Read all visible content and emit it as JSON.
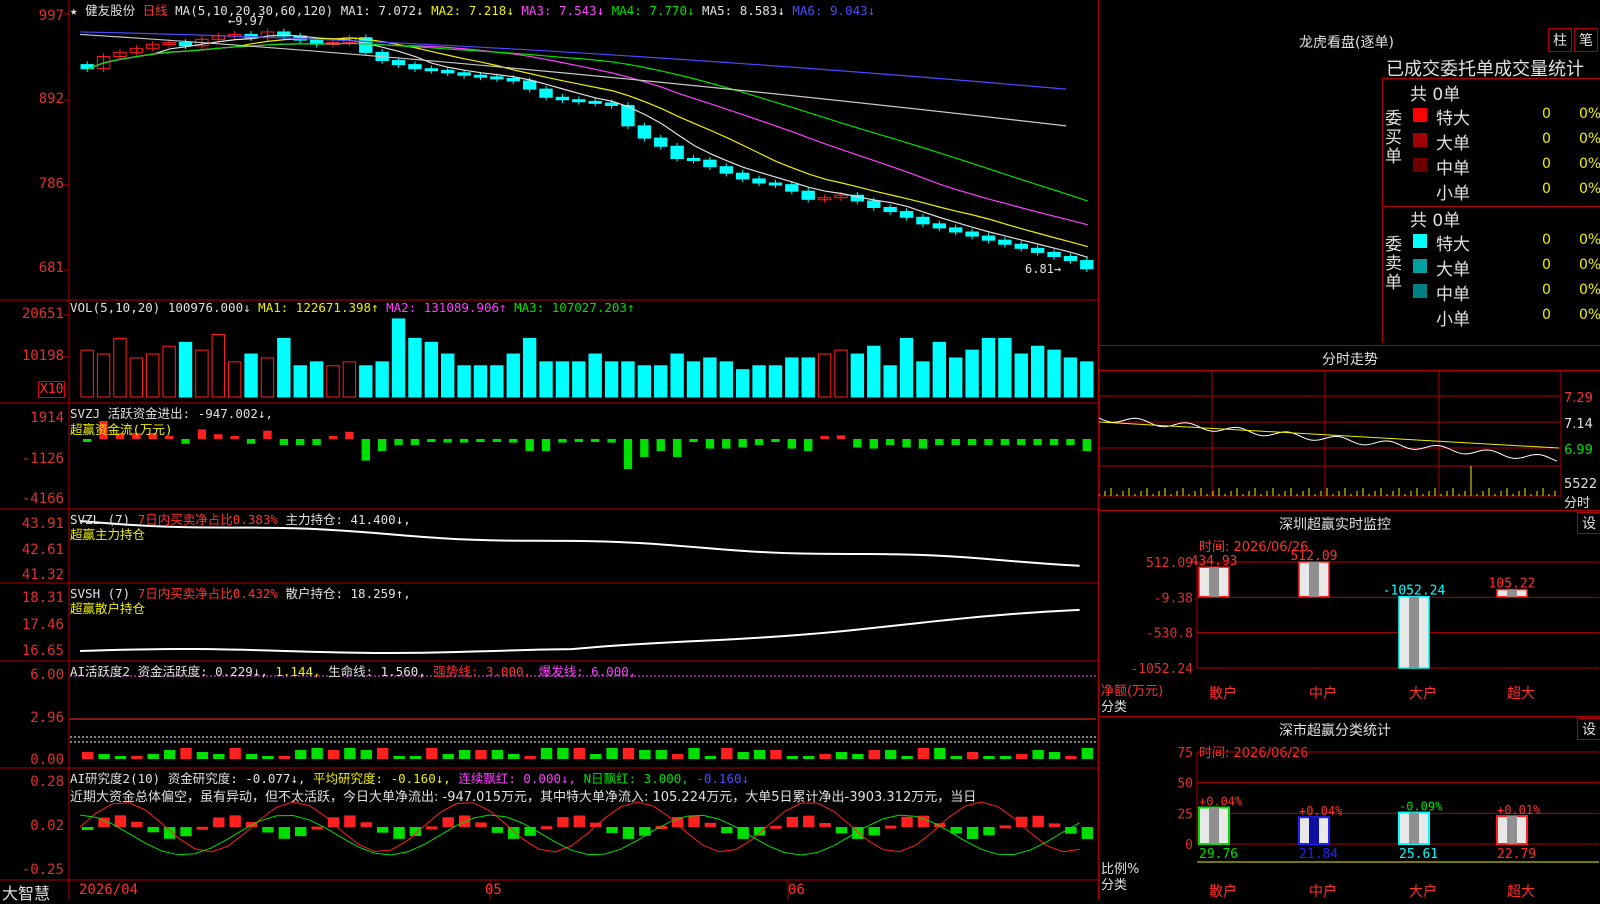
{
  "stock": {
    "name": "健友股份",
    "period": "日线"
  },
  "main_chart": {
    "ma_header": "MA(5,10,20,30,60,120)",
    "ma_values": [
      {
        "label": "MA1:",
        "value": "7.072↓",
        "color": "#e0e0e0"
      },
      {
        "label": "MA2:",
        "value": "7.218↓",
        "color": "#f0f000"
      },
      {
        "label": "MA3:",
        "value": "7.543↓",
        "color": "#ff40ff"
      },
      {
        "label": "MA4:",
        "value": "7.770↓",
        "color": "#00e000"
      },
      {
        "label": "MA5:",
        "value": "8.583↓",
        "color": "#c8c8c8"
      },
      {
        "label": "MA6:",
        "value": "9.043↓",
        "color": "#4a4aff"
      }
    ],
    "y_ticks": [
      "997",
      "892",
      "786",
      "681"
    ],
    "high_label": "←9.97",
    "low_label": "6.81→"
  },
  "vol": {
    "header": "VOL(5,10,20)",
    "value": "100976.000↓",
    "ma1": "MA1: 122671.398↑",
    "ma2": "MA2: 131089.906↑",
    "ma3": "MA3: 107027.203↑",
    "y_ticks": [
      "20651",
      "10198"
    ],
    "unit": "X10"
  },
  "svzj": {
    "title": "SVZJ",
    "desc": "活跃资金进出: -947.002↓,",
    "subtitle": "超赢资金流(万元)",
    "y_ticks": [
      "1914",
      "-1126",
      "-4166"
    ]
  },
  "svzl": {
    "title": "SVZL (7)",
    "desc": "7日内买卖净占比0.383%",
    "value": "主力持仓: 41.400↓,",
    "subtitle": "超赢主力持仓",
    "y_ticks": [
      "43.91",
      "42.61",
      "41.32"
    ]
  },
  "svsh": {
    "title": "SVSH (7)",
    "desc": "7日内买卖净占比0.432%",
    "value": "散户持仓: 18.259↑,",
    "subtitle": "超赢散户持仓",
    "y_ticks": [
      "18.31",
      "17.46",
      "16.65"
    ]
  },
  "ai_active": {
    "title": "AI活跃度2",
    "a": "资金活跃度: 0.229↓,",
    "b": "1.144,",
    "c": "生命线: 1.560,",
    "d": "强势线: 3.000,",
    "e": "爆发线: 6.000,",
    "y_ticks": [
      "6.00",
      "2.96",
      "0.00"
    ]
  },
  "ai_research": {
    "title": "AI研究度2(10)",
    "a": "资金研究度: -0.077↓,",
    "b": "平均研究度: -0.160↓,",
    "c": "连续飘红: 0.000↓,",
    "d": "N日飘红: 3.000,",
    "e": "-0.160↓",
    "text": "近期大资金总体偏空，虽有异动，但不太活跃，今日大单净流出: -947.015万元，其中特大单净流入: 105.224万元，大单5日累计净出-3903.312万元，当日",
    "y_ticks": [
      "0.28",
      "0.02",
      "-0.25"
    ]
  },
  "x_axis": {
    "logo": "大智慧",
    "labels": [
      "2026/04",
      "05",
      "06"
    ]
  },
  "right": {
    "lhb_title": "龙虎看盘(逐单)",
    "btn_col": "柱",
    "btn_bi": "笔",
    "table_title": "已成交委托单成交量统计",
    "buy_label": "委买单",
    "sell_label": "委卖单",
    "buy_total": "共 0单",
    "sell_total": "共 0单",
    "buy_rows": [
      {
        "name": "特大",
        "n": "0",
        "p": "0%",
        "color": "#ff0000"
      },
      {
        "name": "大单",
        "n": "0",
        "p": "0%",
        "color": "#a00000"
      },
      {
        "name": "中单",
        "n": "0",
        "p": "0%",
        "color": "#700000"
      },
      {
        "name": "小单",
        "n": "0",
        "p": "0%",
        "color": "#000000"
      }
    ],
    "sell_rows": [
      {
        "name": "特大",
        "n": "0",
        "p": "0%",
        "color": "#00ffff"
      },
      {
        "name": "大单",
        "n": "0",
        "p": "0%",
        "color": "#00a0a0"
      },
      {
        "name": "中单",
        "n": "0",
        "p": "0%",
        "color": "#008080"
      },
      {
        "name": "小单",
        "n": "0",
        "p": "0%",
        "color": "#000000"
      }
    ],
    "intraday_title": "分时走势",
    "intraday_y": [
      "7.29",
      "7.14",
      "6.99",
      "5522",
      "分时"
    ],
    "monitor_title": "深圳超赢实时监控",
    "set": "设",
    "monitor_time": "时间: 2026/06/26",
    "monitor_y": [
      "512.09",
      "-9.38",
      "-530.8",
      "-1052.24"
    ],
    "monitor_unit": "净额(万元)",
    "monitor_cls": "分类",
    "monitor_bars": [
      {
        "label": "434.93",
        "value": 434.93
      },
      {
        "label": "512.09",
        "value": 512.09
      },
      {
        "label": "-1052.24",
        "value": -1052.24
      },
      {
        "label": "105.22",
        "value": 105.22
      }
    ],
    "cats": [
      "散户",
      "中户",
      "大户",
      "超大"
    ],
    "stat_title": "深市超赢分类统计",
    "stat_time": "时间: 2026/06/26",
    "stat_y": [
      "75",
      "50",
      "25",
      "0"
    ],
    "stat_unit": "比例%",
    "stat_cls": "分类",
    "stat_bars": [
      {
        "top": "+0.04%",
        "bottom": "29.76",
        "value": 29.76
      },
      {
        "top": "+0.04%",
        "bottom": "21.84",
        "value": 21.84
      },
      {
        "top": "-0.09%",
        "bottom": "25.61",
        "value": 25.61
      },
      {
        "top": "+0.01%",
        "bottom": "22.79",
        "value": 22.79
      }
    ]
  },
  "chart_data": {
    "type": "candlestick",
    "title": "健友股份 日线",
    "y_range": [
      6.81,
      9.97
    ],
    "candles_close": [
      9.3,
      9.45,
      9.5,
      9.55,
      9.6,
      9.62,
      9.58,
      9.66,
      9.7,
      9.72,
      9.68,
      9.75,
      9.7,
      9.65,
      9.6,
      9.62,
      9.68,
      9.5,
      9.4,
      9.35,
      9.3,
      9.28,
      9.25,
      9.22,
      9.2,
      9.18,
      9.15,
      9.05,
      8.95,
      8.92,
      8.9,
      8.88,
      8.85,
      8.6,
      8.45,
      8.35,
      8.2,
      8.18,
      8.1,
      8.02,
      7.95,
      7.9,
      7.88,
      7.8,
      7.7,
      7.72,
      7.75,
      7.68,
      7.6,
      7.55,
      7.48,
      7.4,
      7.35,
      7.3,
      7.25,
      7.2,
      7.15,
      7.1,
      7.05,
      7.0,
      6.95,
      6.85
    ],
    "volume": [
      12,
      11,
      15,
      10,
      11,
      13,
      14,
      12,
      16,
      9,
      11,
      10,
      15,
      8,
      9,
      8,
      9,
      8,
      9,
      20,
      15,
      14,
      11,
      8,
      8,
      8,
      11,
      15,
      9,
      9,
      9,
      11,
      9,
      9,
      8,
      8,
      11,
      9,
      10,
      9,
      7,
      8,
      8,
      10,
      10,
      11,
      12,
      11,
      13,
      8,
      15,
      9,
      14,
      10,
      12,
      15,
      15,
      11,
      13,
      12,
      10,
      9
    ]
  }
}
